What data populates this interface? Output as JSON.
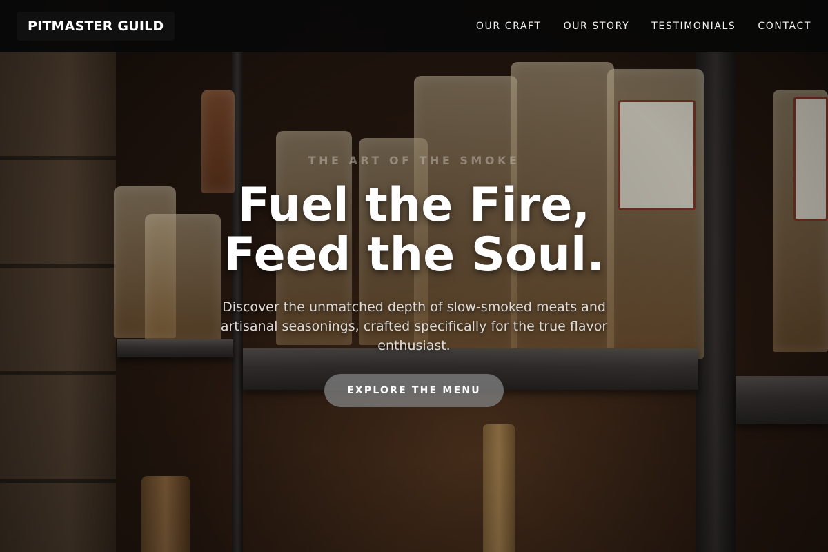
{
  "nav": {
    "brand": "PITMASTER GUILD",
    "links": [
      "OUR CRAFT",
      "OUR STORY",
      "TESTIMONIALS",
      "CONTACT"
    ]
  },
  "hero": {
    "eyebrow": "THE ART OF THE SMOKE",
    "headline_line1": "Fuel the Fire,",
    "headline_line2": "Feed the Soul.",
    "subtext": "Discover the unmatched depth of slow-smoked meats and artisanal seasonings, crafted specifically for the true flavor enthusiast.",
    "cta_label": "EXPLORE THE MENU"
  },
  "colors": {
    "navbar_bg": "#080808",
    "headline": "#ffffff",
    "cta_bg": "#787878"
  }
}
